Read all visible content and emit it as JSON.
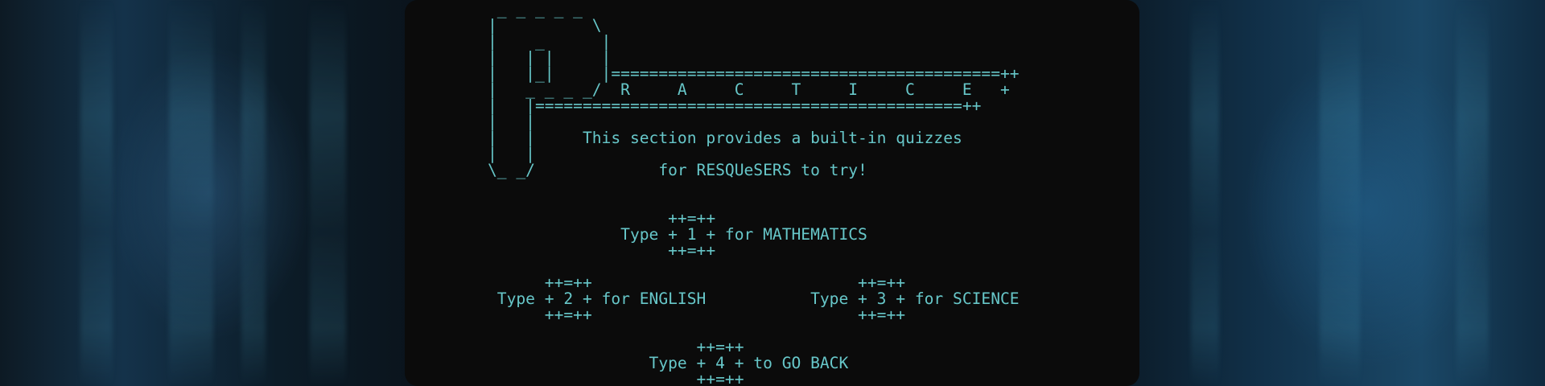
{
  "terminal": {
    "banner_lines": [
      " _ _ _ _ _",
      "|          \\",
      "|    _      |",
      "|   | |     |",
      "|   |_|     |=========================================++",
      "|   _ _ _ _/  R     A     C     T     I     C     E   +",
      "|   |=============================================++",
      "|   |",
      "|   |     This section provides a built-in quizzes",
      "|   |",
      "\\_ _/             for RESQUeSERS to try!"
    ],
    "menu_lines": [
      "",
      "",
      "                   ++=++",
      "              Type + 1 + for MATHEMATICS",
      "                   ++=++",
      "",
      "      ++=++                            ++=++",
      " Type + 2 + for ENGLISH           Type + 3 + for SCIENCE",
      "      ++=++                            ++=++",
      "",
      "                      ++=++",
      "                 Type + 4 + to GO BACK",
      "                      ++=++"
    ]
  },
  "colors": {
    "text": "#67c7c9",
    "panel": "#0b0b0b"
  }
}
